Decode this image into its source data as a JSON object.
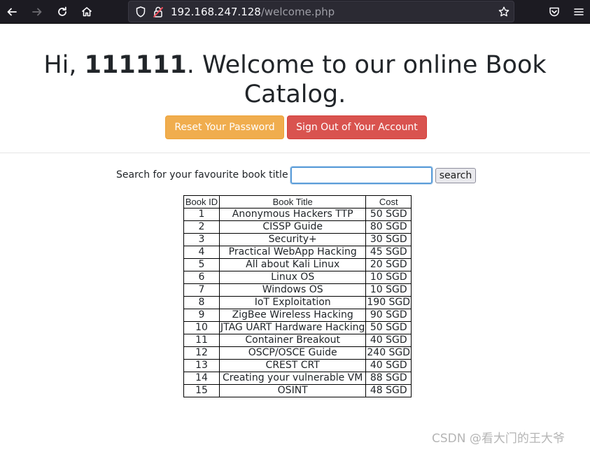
{
  "browser": {
    "url_host": "192.168.247.128",
    "url_path": "/welcome.php"
  },
  "header": {
    "greeting": "Hi, ",
    "username": "111111",
    "welcome": ". Welcome to our online Book Catalog."
  },
  "buttons": {
    "reset_label": "Reset Your Password",
    "signout_label": "Sign Out of Your Account"
  },
  "search": {
    "label": "Search for your favourite book title",
    "value": "",
    "button_label": "search"
  },
  "table": {
    "headers": [
      "Book ID",
      "Book Title",
      "Cost"
    ],
    "rows": [
      [
        "1",
        "Anonymous Hackers TTP",
        "50 SGD"
      ],
      [
        "2",
        "CISSP Guide",
        "80 SGD"
      ],
      [
        "3",
        "Security+",
        "30 SGD"
      ],
      [
        "4",
        "Practical WebApp Hacking",
        "45 SGD"
      ],
      [
        "5",
        "All about Kali Linux",
        "20 SGD"
      ],
      [
        "6",
        "Linux OS",
        "10 SGD"
      ],
      [
        "7",
        "Windows OS",
        "10 SGD"
      ],
      [
        "8",
        "IoT Exploitation",
        "190 SGD"
      ],
      [
        "9",
        "ZigBee Wireless Hacking",
        "90 SGD"
      ],
      [
        "10",
        "JTAG UART Hardware Hacking",
        "50 SGD"
      ],
      [
        "11",
        "Container Breakout",
        "40 SGD"
      ],
      [
        "12",
        "OSCP/OSCE Guide",
        "240 SGD"
      ],
      [
        "13",
        "CREST CRT",
        "40 SGD"
      ],
      [
        "14",
        "Creating your vulnerable VM",
        "88 SGD"
      ],
      [
        "15",
        "OSINT",
        "48 SGD"
      ]
    ]
  },
  "watermark": "CSDN @看大门的王大爷",
  "colors": {
    "toolbar": "#1c1b22",
    "warning": "#f0ad4e",
    "danger": "#d9534f",
    "focus": "#5b9dd9"
  },
  "icons": [
    "back-icon",
    "forward-icon",
    "reload-icon",
    "home-icon",
    "shield-icon",
    "insecure-lock-icon",
    "star-icon",
    "pocket-icon",
    "menu-icon"
  ]
}
